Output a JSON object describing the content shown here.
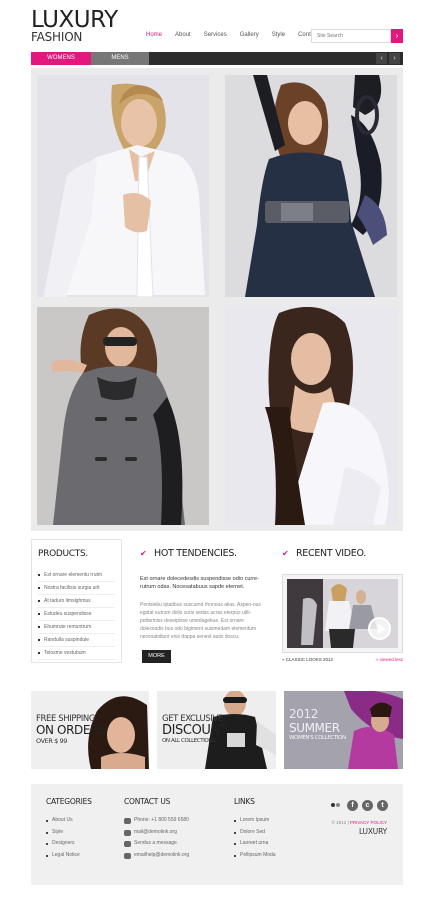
{
  "brand": {
    "name": "LUXURY",
    "sub": "FASHION"
  },
  "nav": [
    {
      "label": "Home",
      "active": true
    },
    {
      "label": "About"
    },
    {
      "label": "Services"
    },
    {
      "label": "Gallery"
    },
    {
      "label": "Style"
    },
    {
      "label": "Contacts"
    }
  ],
  "search": {
    "placeholder": "Site Search",
    "button": "›"
  },
  "category_bar": {
    "women": "WOMENS",
    "men": "MENS",
    "prev": "‹",
    "next": "›"
  },
  "products": {
    "title": "PRODUCTS.",
    "items": [
      "Est ornare elementu rrutm",
      "Nostra facilisis surgia urit",
      "At taduro limsighmus",
      "Estudeu suspendisse",
      "Ehumrute remuntrum",
      "Randulla suspindule",
      "Telosme vestubum"
    ]
  },
  "hot": {
    "title": "HOT TENDENCIES.",
    "lead": "Est ornare dolecedesdis suspendisse odio curre-rutrum odas. Nocesatabuus sapde eternet.",
    "body": "Penisiebu iptatibus suscumd rhonous alias. Aspen-ous egidat eutrum dolis suris sedas acras eterpus utili-potteriniss deseipisse umedagetiue. Est ornare dolecesdis bus odo bigiment suismedam elementum necesatidiunt enis dappa senest autis doscu.",
    "more": "MORE"
  },
  "video": {
    "title": "RECENT VIDEO.",
    "caption": "» CLASSIC LOOKS 2012",
    "caption_right": "» viewed less"
  },
  "promos": [
    {
      "line1": "FREE SHIPPING",
      "line2": "ON ORDERS",
      "line3": "OVER $ 99"
    },
    {
      "line1": "GET EXCLUSIVE",
      "line2": "DISCOUNT",
      "line3": "ON ALL COLLECTIONS"
    },
    {
      "line1": "2012",
      "line2": "SUMMER",
      "line3": "WOMEN'S COLLECTION"
    }
  ],
  "footer": {
    "categories": {
      "title": "CATEGORIES",
      "items": [
        "About Us",
        "Style",
        "Designers",
        "Legal Notice"
      ]
    },
    "contact": {
      "title": "CONTACT US",
      "items": [
        "Phone: +1 800 559 6580",
        "mail@demolink.org",
        "Sendus a message",
        "emailhelp@demolink.org"
      ]
    },
    "links": {
      "title": "LINKS",
      "items": [
        "Lorem Ipsum",
        "Dolore Sed",
        "Laoreet urna",
        "Pellipsum Moda"
      ]
    },
    "copyright": "© 2012 |",
    "privacy": "PRIVACY POLICY",
    "logo": "LUXURY"
  },
  "colors": {
    "accent": "#e3177e",
    "dark": "#2c2c2c"
  }
}
